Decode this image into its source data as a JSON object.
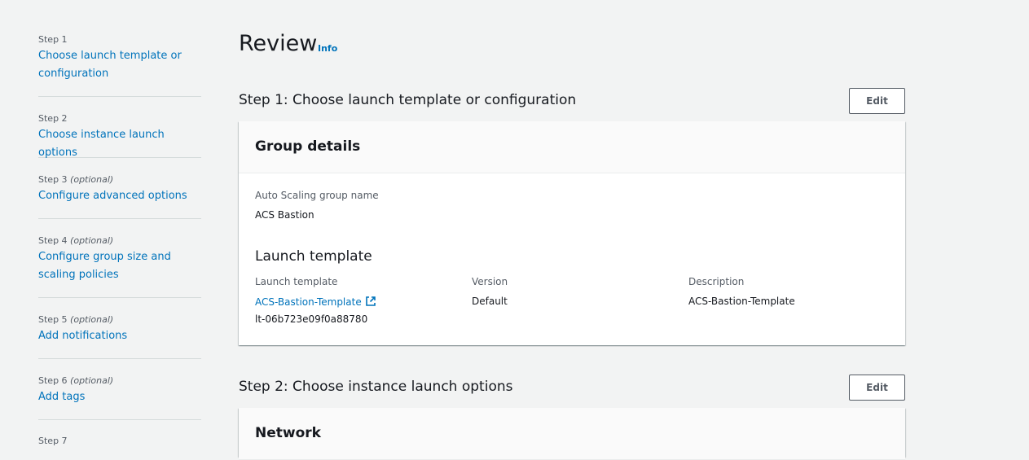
{
  "sidebar": {
    "steps": [
      {
        "step": "Step 1",
        "optional": "",
        "label": "Choose launch template or configuration"
      },
      {
        "step": "Step 2",
        "optional": "",
        "label": "Choose instance launch options"
      },
      {
        "step": "Step 3",
        "optional": "(optional)",
        "label": "Configure advanced options"
      },
      {
        "step": "Step 4",
        "optional": "(optional)",
        "label": "Configure group size and scaling policies"
      },
      {
        "step": "Step 5",
        "optional": "(optional)",
        "label": "Add notifications"
      },
      {
        "step": "Step 6",
        "optional": "(optional)",
        "label": "Add tags"
      },
      {
        "step": "Step 7",
        "optional": "",
        "label": ""
      }
    ]
  },
  "page": {
    "title": "Review",
    "info": "Info"
  },
  "section1": {
    "title": "Step 1: Choose launch template or configuration",
    "edit": "Edit",
    "card_title": "Group details",
    "asg_name_label": "Auto Scaling group name",
    "asg_name_value": "ACS Bastion",
    "lt_heading": "Launch template",
    "lt_label": "Launch template",
    "lt_link": "ACS-Bastion-Template",
    "lt_id": "lt-06b723e09f0a88780",
    "version_label": "Version",
    "version_value": "Default",
    "desc_label": "Description",
    "desc_value": "ACS-Bastion-Template"
  },
  "section2": {
    "title": "Step 2: Choose instance launch options",
    "edit": "Edit",
    "card_title": "Network"
  },
  "icons": {
    "external": "external-link-icon"
  },
  "colors": {
    "link": "#0073bb",
    "background": "#f2f3f3"
  }
}
